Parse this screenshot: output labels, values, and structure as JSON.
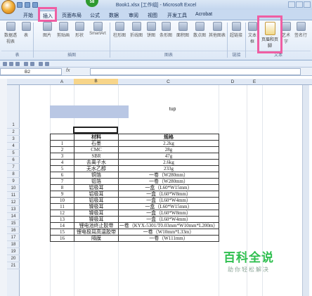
{
  "window": {
    "title": "Book1.xlsx [工作组] - Microsoft Excel"
  },
  "ribbon": {
    "tabs": [
      "开始",
      "插入",
      "页面布局",
      "公式",
      "数据",
      "审阅",
      "视图",
      "开发工具",
      "Acrobat"
    ],
    "buttons": {
      "pivot": "数据透视表",
      "table": "表",
      "picture": "图片",
      "clipart": "剪贴画",
      "shape": "形状",
      "smartart": "SmartArt",
      "column": "柱形图",
      "line": "折线图",
      "pie": "饼图",
      "bar": "条形图",
      "area": "面积图",
      "scatter": "散点图",
      "other": "其他图表",
      "hyperlink": "超链接",
      "textbox": "文本框",
      "headerfooter": "页眉和页脚",
      "art": "艺术字",
      "sign": "签名行"
    },
    "groups": [
      "表",
      "插图",
      "图表",
      "链接",
      "文本"
    ]
  },
  "formula": {
    "namebox": "B2",
    "fx": "fx"
  },
  "columns": [
    "A",
    "B",
    "C",
    "D",
    "E"
  ],
  "rows": [
    "1",
    "2",
    "3",
    "4",
    "5",
    "6",
    "7",
    "8",
    "9",
    "10",
    "11",
    "12",
    "13",
    "14",
    "15",
    "16",
    "17",
    "18",
    "19",
    "20",
    "21"
  ],
  "sheet": {
    "cell_tup": "tup",
    "headers": [
      "",
      "材料",
      "规格"
    ],
    "items": [
      [
        "1",
        "石墨",
        "2.2kg"
      ],
      [
        "2",
        "CMC",
        "28g"
      ],
      [
        "3",
        "SBR",
        "47g"
      ],
      [
        "4",
        "去离子水",
        "2.6kg"
      ],
      [
        "5",
        "无水乙醇",
        "233g"
      ],
      [
        "6",
        "铜箔",
        "一卷（W280mm）"
      ],
      [
        "7",
        "铝箔",
        "一卷（W280mm）"
      ],
      [
        "8",
        "铝极耳",
        "一盒（L60*W15mm）"
      ],
      [
        "9",
        "铝极耳",
        "一盒（L60*W8mm）"
      ],
      [
        "10",
        "铝极耳",
        "一盒（L60*W4mm）"
      ],
      [
        "11",
        "镍极耳",
        "一盒（L60*W15mm）"
      ],
      [
        "12",
        "镍极耳",
        "一盒（L60*W8mm）"
      ],
      [
        "13",
        "镍极耳",
        "一盒（L60*W4mm）"
      ],
      [
        "14",
        "锂电池终止胶带",
        "一卷（KYX-5301/T0.03mm*W10mm*L200m）"
      ],
      [
        "15",
        "锂电极耳高温胶带",
        "一卷（W10mm*L33m）"
      ],
      [
        "16",
        "隔膜",
        "一卷（W111mm）"
      ]
    ]
  },
  "watermark": {
    "main": "百科全说",
    "sub": "助你轻松解决"
  },
  "colors": {
    "highlight": "#ef5ea3",
    "watermark": "#2fbf4f"
  }
}
